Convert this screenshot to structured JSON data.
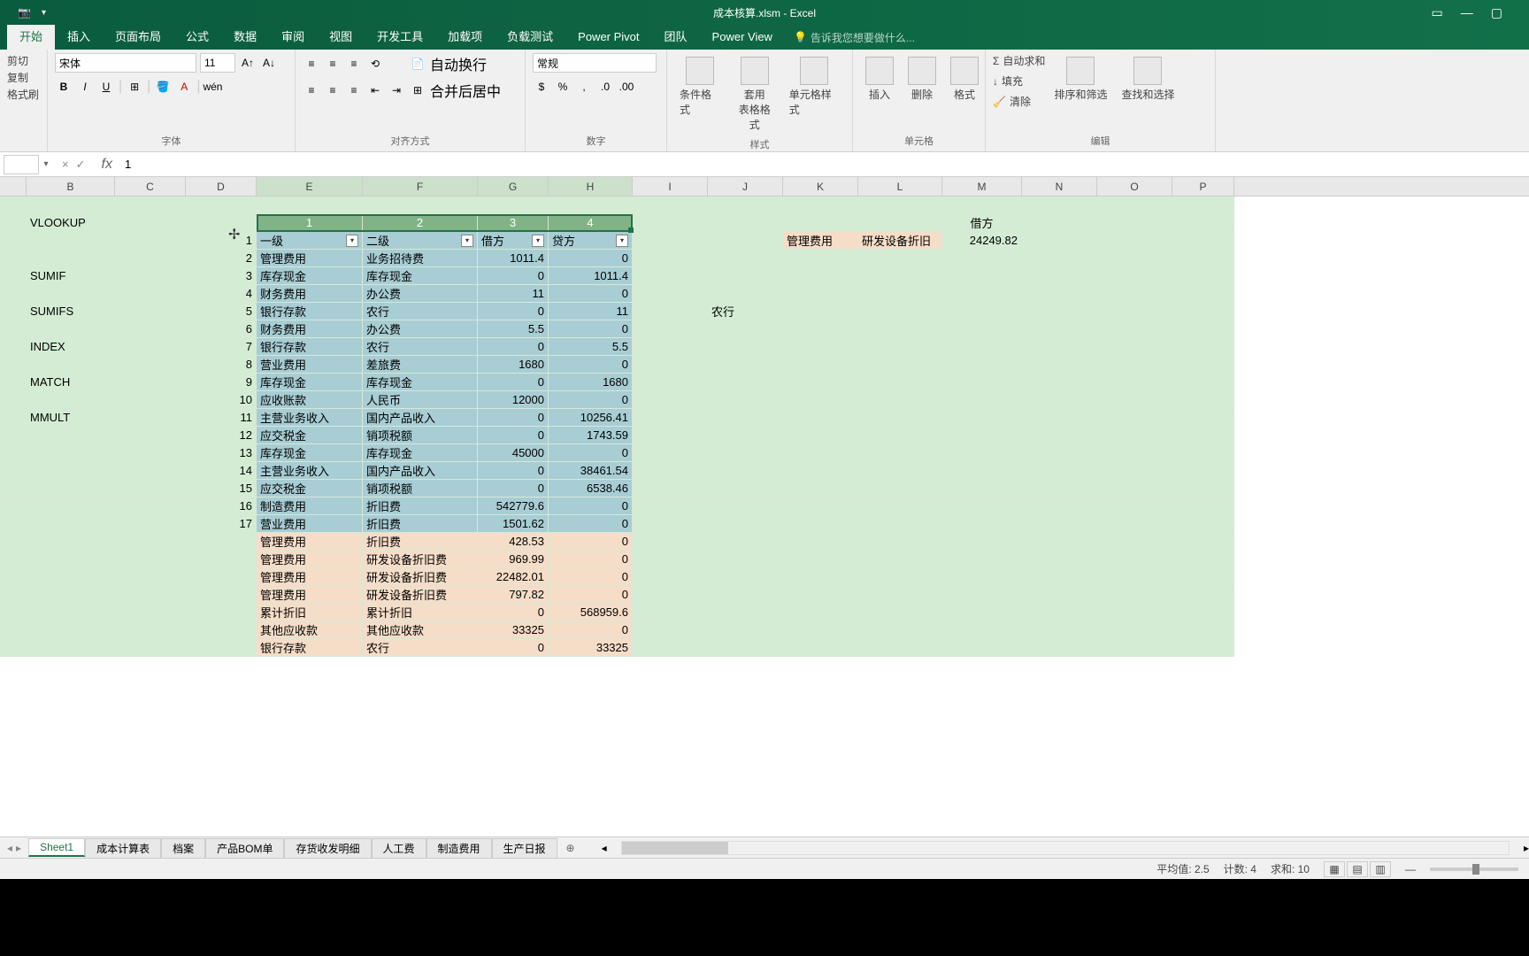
{
  "titlebar": {
    "title": "成本核算.xlsm - Excel"
  },
  "ribbon_tabs": [
    "开始",
    "插入",
    "页面布局",
    "公式",
    "数据",
    "审阅",
    "视图",
    "开发工具",
    "加载项",
    "负载测试",
    "Power Pivot",
    "团队",
    "Power View"
  ],
  "ribbon_tellme": "告诉我您想要做什么...",
  "ribbon": {
    "clipboard": {
      "cut": "剪切",
      "copy": "复制",
      "paste": "格式刷",
      "label": ""
    },
    "font": {
      "name": "宋体",
      "size": "11",
      "label": "字体",
      "bold": "B",
      "italic": "I",
      "underline": "U",
      "wen": "wén"
    },
    "align": {
      "label": "对齐方式",
      "wrap": "自动换行",
      "merge": "合并后居中"
    },
    "number": {
      "label": "数字",
      "format": "常规"
    },
    "styles": {
      "cond": "条件格式",
      "table": "套用\n表格格式",
      "cell": "单元格样式",
      "label": "样式"
    },
    "cells": {
      "insert": "插入",
      "delete": "删除",
      "format": "格式",
      "label": "单元格"
    },
    "editing": {
      "sum": "自动求和",
      "fill": "填充",
      "clear": "清除",
      "sort": "排序和筛选",
      "find": "查找和选择",
      "label": "编辑"
    }
  },
  "formula": {
    "value": "1"
  },
  "columns": [
    "B",
    "C",
    "D",
    "E",
    "F",
    "G",
    "H",
    "I",
    "J",
    "K",
    "L",
    "M",
    "N",
    "O",
    "P"
  ],
  "side_labels": [
    "VLOOKUP",
    "",
    "SUMIF",
    "",
    "SUMIFS",
    "",
    "INDEX",
    "",
    "MATCH",
    "",
    "MMULT"
  ],
  "header_numbers": [
    "1",
    "2",
    "3",
    "4"
  ],
  "table_headers": [
    "一级",
    "二级",
    "借方",
    "贷方"
  ],
  "row_numbers_D": [
    "1",
    "2",
    "3",
    "4",
    "5",
    "6",
    "7",
    "8",
    "9",
    "10",
    "11",
    "12",
    "13",
    "14",
    "15",
    "16",
    "17"
  ],
  "table_rows": [
    {
      "e": "管理费用",
      "f": "业务招待费",
      "g": "1011.4",
      "h": "0"
    },
    {
      "e": "库存现金",
      "f": "库存现金",
      "g": "0",
      "h": "1011.4"
    },
    {
      "e": "财务费用",
      "f": "办公费",
      "g": "11",
      "h": "0"
    },
    {
      "e": "银行存款",
      "f": "农行",
      "g": "0",
      "h": "11"
    },
    {
      "e": "财务费用",
      "f": "办公费",
      "g": "5.5",
      "h": "0"
    },
    {
      "e": "银行存款",
      "f": "农行",
      "g": "0",
      "h": "5.5"
    },
    {
      "e": "营业费用",
      "f": "差旅费",
      "g": "1680",
      "h": "0"
    },
    {
      "e": "库存现金",
      "f": "库存现金",
      "g": "0",
      "h": "1680"
    },
    {
      "e": "应收账款",
      "f": "人民币",
      "g": "12000",
      "h": "0"
    },
    {
      "e": "主营业务收入",
      "f": "国内产品收入",
      "g": "0",
      "h": "10256.41"
    },
    {
      "e": "应交税金",
      "f": "销项税额",
      "g": "0",
      "h": "1743.59"
    },
    {
      "e": "库存现金",
      "f": "库存现金",
      "g": "45000",
      "h": "0"
    },
    {
      "e": "主营业务收入",
      "f": "国内产品收入",
      "g": "0",
      "h": "38461.54"
    },
    {
      "e": "应交税金",
      "f": "销项税额",
      "g": "0",
      "h": "6538.46"
    },
    {
      "e": "制造费用",
      "f": "折旧费",
      "g": "542779.6",
      "h": "0"
    },
    {
      "e": "营业费用",
      "f": "折旧费",
      "g": "1501.62",
      "h": "0"
    }
  ],
  "peach_rows": [
    {
      "e": "管理费用",
      "f": "折旧费",
      "g": "428.53",
      "h": "0"
    },
    {
      "e": "管理费用",
      "f": "研发设备折旧费",
      "g": "969.99",
      "h": "0"
    },
    {
      "e": "管理费用",
      "f": "研发设备折旧费",
      "g": "22482.01",
      "h": "0"
    },
    {
      "e": "管理费用",
      "f": "研发设备折旧费",
      "g": "797.82",
      "h": "0"
    },
    {
      "e": "累计折旧",
      "f": "累计折旧",
      "g": "0",
      "h": "568959.6"
    },
    {
      "e": "其他应收款",
      "f": "其他应收款",
      "g": "33325",
      "h": "0"
    },
    {
      "e": "银行存款",
      "f": "农行",
      "g": "0",
      "h": "33325"
    }
  ],
  "right_panel": {
    "m_header": "借方",
    "k": "管理费用",
    "l": "研发设备折旧",
    "m": "24249.82",
    "j5": "农行"
  },
  "sheets": [
    "Sheet1",
    "成本计算表",
    "档案",
    "产品BOM单",
    "存货收发明细",
    "人工费",
    "制造费用",
    "生产日报"
  ],
  "status": {
    "avg": "平均值: 2.5",
    "count": "计数: 4",
    "sum": "求和: 10"
  }
}
